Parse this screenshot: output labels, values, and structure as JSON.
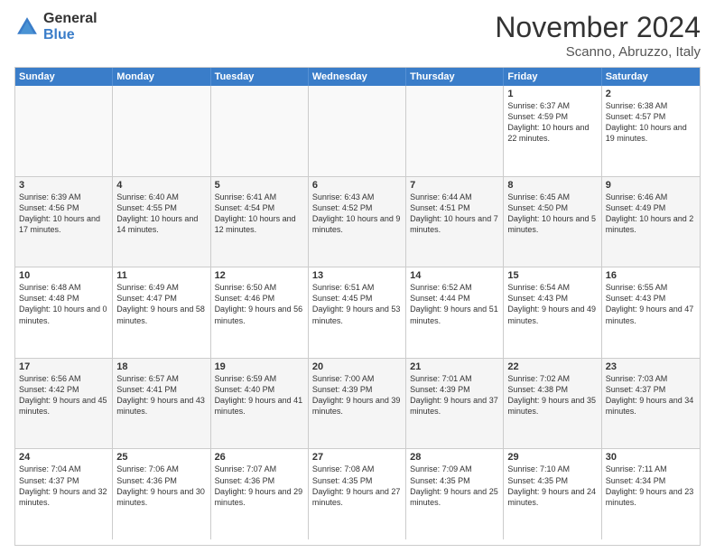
{
  "logo": {
    "general": "General",
    "blue": "Blue"
  },
  "header": {
    "month": "November 2024",
    "location": "Scanno, Abruzzo, Italy"
  },
  "weekdays": [
    "Sunday",
    "Monday",
    "Tuesday",
    "Wednesday",
    "Thursday",
    "Friday",
    "Saturday"
  ],
  "weeks": [
    [
      {
        "day": "",
        "info": ""
      },
      {
        "day": "",
        "info": ""
      },
      {
        "day": "",
        "info": ""
      },
      {
        "day": "",
        "info": ""
      },
      {
        "day": "",
        "info": ""
      },
      {
        "day": "1",
        "info": "Sunrise: 6:37 AM\nSunset: 4:59 PM\nDaylight: 10 hours\nand 22 minutes."
      },
      {
        "day": "2",
        "info": "Sunrise: 6:38 AM\nSunset: 4:57 PM\nDaylight: 10 hours\nand 19 minutes."
      }
    ],
    [
      {
        "day": "3",
        "info": "Sunrise: 6:39 AM\nSunset: 4:56 PM\nDaylight: 10 hours\nand 17 minutes."
      },
      {
        "day": "4",
        "info": "Sunrise: 6:40 AM\nSunset: 4:55 PM\nDaylight: 10 hours\nand 14 minutes."
      },
      {
        "day": "5",
        "info": "Sunrise: 6:41 AM\nSunset: 4:54 PM\nDaylight: 10 hours\nand 12 minutes."
      },
      {
        "day": "6",
        "info": "Sunrise: 6:43 AM\nSunset: 4:52 PM\nDaylight: 10 hours\nand 9 minutes."
      },
      {
        "day": "7",
        "info": "Sunrise: 6:44 AM\nSunset: 4:51 PM\nDaylight: 10 hours\nand 7 minutes."
      },
      {
        "day": "8",
        "info": "Sunrise: 6:45 AM\nSunset: 4:50 PM\nDaylight: 10 hours\nand 5 minutes."
      },
      {
        "day": "9",
        "info": "Sunrise: 6:46 AM\nSunset: 4:49 PM\nDaylight: 10 hours\nand 2 minutes."
      }
    ],
    [
      {
        "day": "10",
        "info": "Sunrise: 6:48 AM\nSunset: 4:48 PM\nDaylight: 10 hours\nand 0 minutes."
      },
      {
        "day": "11",
        "info": "Sunrise: 6:49 AM\nSunset: 4:47 PM\nDaylight: 9 hours\nand 58 minutes."
      },
      {
        "day": "12",
        "info": "Sunrise: 6:50 AM\nSunset: 4:46 PM\nDaylight: 9 hours\nand 56 minutes."
      },
      {
        "day": "13",
        "info": "Sunrise: 6:51 AM\nSunset: 4:45 PM\nDaylight: 9 hours\nand 53 minutes."
      },
      {
        "day": "14",
        "info": "Sunrise: 6:52 AM\nSunset: 4:44 PM\nDaylight: 9 hours\nand 51 minutes."
      },
      {
        "day": "15",
        "info": "Sunrise: 6:54 AM\nSunset: 4:43 PM\nDaylight: 9 hours\nand 49 minutes."
      },
      {
        "day": "16",
        "info": "Sunrise: 6:55 AM\nSunset: 4:43 PM\nDaylight: 9 hours\nand 47 minutes."
      }
    ],
    [
      {
        "day": "17",
        "info": "Sunrise: 6:56 AM\nSunset: 4:42 PM\nDaylight: 9 hours\nand 45 minutes."
      },
      {
        "day": "18",
        "info": "Sunrise: 6:57 AM\nSunset: 4:41 PM\nDaylight: 9 hours\nand 43 minutes."
      },
      {
        "day": "19",
        "info": "Sunrise: 6:59 AM\nSunset: 4:40 PM\nDaylight: 9 hours\nand 41 minutes."
      },
      {
        "day": "20",
        "info": "Sunrise: 7:00 AM\nSunset: 4:39 PM\nDaylight: 9 hours\nand 39 minutes."
      },
      {
        "day": "21",
        "info": "Sunrise: 7:01 AM\nSunset: 4:39 PM\nDaylight: 9 hours\nand 37 minutes."
      },
      {
        "day": "22",
        "info": "Sunrise: 7:02 AM\nSunset: 4:38 PM\nDaylight: 9 hours\nand 35 minutes."
      },
      {
        "day": "23",
        "info": "Sunrise: 7:03 AM\nSunset: 4:37 PM\nDaylight: 9 hours\nand 34 minutes."
      }
    ],
    [
      {
        "day": "24",
        "info": "Sunrise: 7:04 AM\nSunset: 4:37 PM\nDaylight: 9 hours\nand 32 minutes."
      },
      {
        "day": "25",
        "info": "Sunrise: 7:06 AM\nSunset: 4:36 PM\nDaylight: 9 hours\nand 30 minutes."
      },
      {
        "day": "26",
        "info": "Sunrise: 7:07 AM\nSunset: 4:36 PM\nDaylight: 9 hours\nand 29 minutes."
      },
      {
        "day": "27",
        "info": "Sunrise: 7:08 AM\nSunset: 4:35 PM\nDaylight: 9 hours\nand 27 minutes."
      },
      {
        "day": "28",
        "info": "Sunrise: 7:09 AM\nSunset: 4:35 PM\nDaylight: 9 hours\nand 25 minutes."
      },
      {
        "day": "29",
        "info": "Sunrise: 7:10 AM\nSunset: 4:35 PM\nDaylight: 9 hours\nand 24 minutes."
      },
      {
        "day": "30",
        "info": "Sunrise: 7:11 AM\nSunset: 4:34 PM\nDaylight: 9 hours\nand 23 minutes."
      }
    ]
  ]
}
